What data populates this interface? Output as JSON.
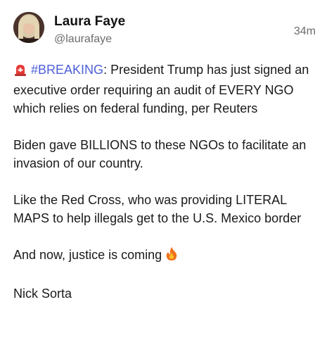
{
  "author": {
    "display_name": "Laura Faye",
    "handle": "@laurafaye"
  },
  "post": {
    "timestamp": "34m",
    "siren_icon": "police-siren-icon",
    "hashtag": "#BREAKING",
    "para1_rest": ": President Trump has just signed an executive order requiring an audit of EVERY NGO which relies on federal funding, per Reuters",
    "para2": "Biden gave BILLIONS to these NGOs to facilitate an invasion of our country.",
    "para3": "Like the Red Cross, who was providing LITERAL MAPS to help illegals get to the U.S. Mexico border",
    "para4": "And now, justice is coming ",
    "fire_icon": "fire-icon",
    "para5": "Nick Sorta"
  },
  "colors": {
    "hashtag": "#4c5fd7",
    "muted_text": "#6b6b6b",
    "body_text": "#1a1a1a"
  }
}
